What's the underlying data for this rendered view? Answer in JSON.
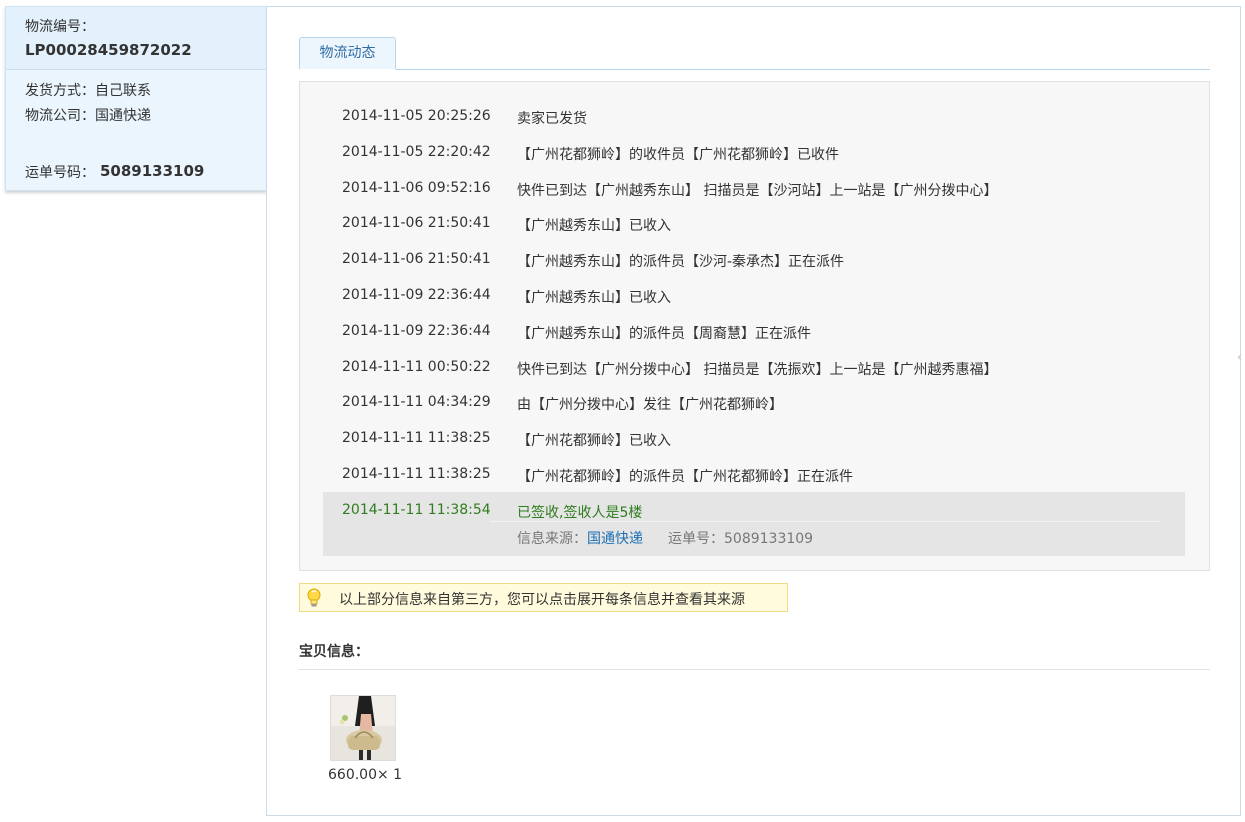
{
  "side": {
    "tracking_label": "物流编号：",
    "tracking_no": "LP00028459872022",
    "ship_method": "发货方式：自己联系",
    "company": "物流公司：国通快递",
    "waybill_label": "运单号码：",
    "waybill_no": "5089133109"
  },
  "tab": {
    "label": "物流动态"
  },
  "events": [
    {
      "time": "2014-11-05 20:25:26",
      "desc": "卖家已发货"
    },
    {
      "time": "2014-11-05 22:20:42",
      "desc": "【广州花都狮岭】的收件员【广州花都狮岭】已收件"
    },
    {
      "time": "2014-11-06 09:52:16",
      "desc": "快件已到达【广州越秀东山】 扫描员是【沙河站】上一站是【广州分拨中心】"
    },
    {
      "time": "2014-11-06 21:50:41",
      "desc": "【广州越秀东山】已收入"
    },
    {
      "time": "2014-11-06 21:50:41",
      "desc": "【广州越秀东山】的派件员【沙河-秦承杰】正在派件"
    },
    {
      "time": "2014-11-09 22:36:44",
      "desc": "【广州越秀东山】已收入"
    },
    {
      "time": "2014-11-09 22:36:44",
      "desc": "【广州越秀东山】的派件员【周裔慧】正在派件"
    },
    {
      "time": "2014-11-11 00:50:22",
      "desc": "快件已到达【广州分拨中心】 扫描员是【冼振欢】上一站是【广州越秀惠福】"
    },
    {
      "time": "2014-11-11 04:34:29",
      "desc": "由【广州分拨中心】发往【广州花都狮岭】"
    },
    {
      "time": "2014-11-11 11:38:25",
      "desc": "【广州花都狮岭】已收入"
    },
    {
      "time": "2014-11-11 11:38:25",
      "desc": "【广州花都狮岭】的派件员【广州花都狮岭】正在派件"
    }
  ],
  "last_event": {
    "time": "2014-11-11 11:38:54",
    "desc": "已签收,签收人是5楼",
    "source_label": "信息来源：",
    "source_link": "国通快递",
    "waybill_label": "运单号：",
    "waybill_no": "5089133109"
  },
  "tip": {
    "text": "以上部分信息来自第三方，您可以点击展开每条信息并查看其来源",
    "icon": "lightbulb-icon"
  },
  "goods": {
    "title": "宝贝信息：",
    "price": "660.00× 1"
  },
  "colors": {
    "accent": "#2e6ea5",
    "signed": "#2f7d1f",
    "link": "#1f6fb2",
    "tip_bg": "#fffbdc"
  }
}
